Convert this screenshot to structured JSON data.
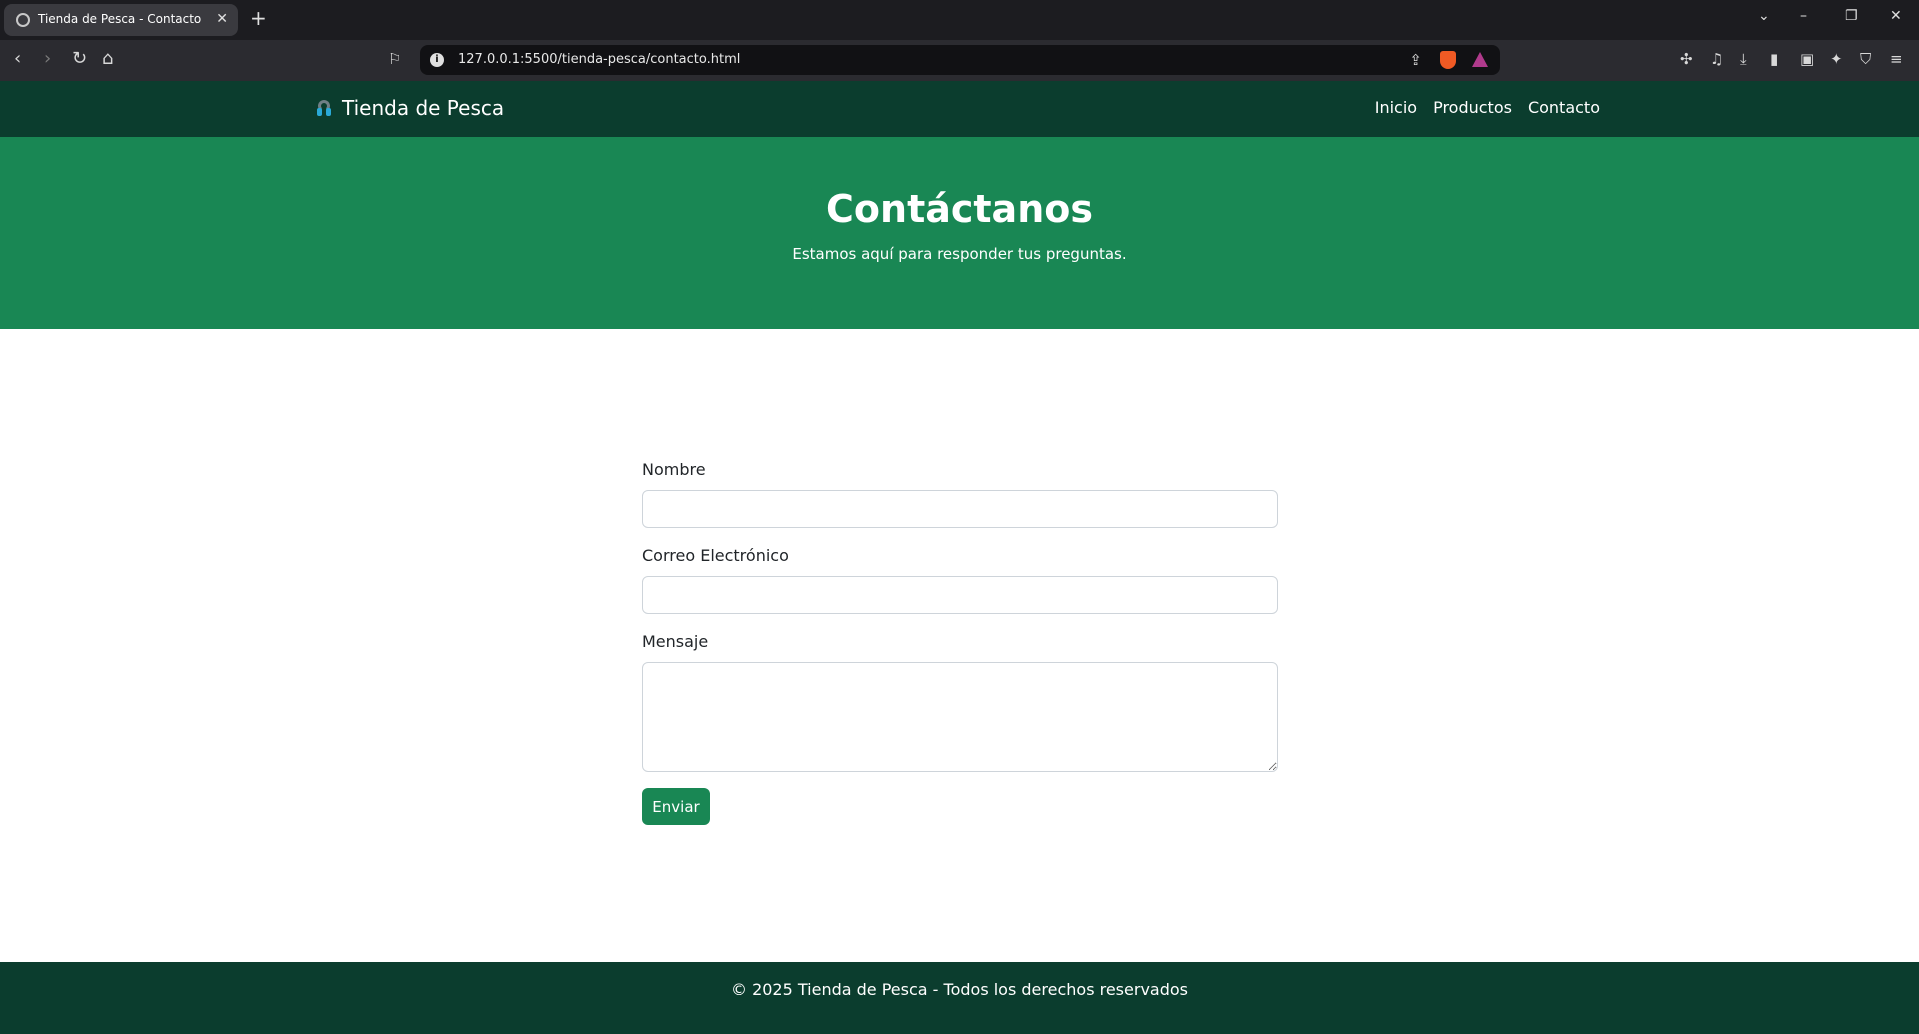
{
  "browser": {
    "tab_title": "Tienda de Pesca - Contacto",
    "url": "127.0.0.1:5500/tienda-pesca/contacto.html"
  },
  "navbar": {
    "brand": "Tienda de Pesca",
    "links": [
      "Inicio",
      "Productos",
      "Contacto"
    ]
  },
  "hero": {
    "title": "Contáctanos",
    "subtitle": "Estamos aquí para responder tus preguntas."
  },
  "form": {
    "name_label": "Nombre",
    "name_value": "",
    "email_label": "Correo Electrónico",
    "email_value": "",
    "message_label": "Mensaje",
    "message_value": "",
    "submit_label": "Enviar"
  },
  "footer": {
    "text": "© 2025 Tienda de Pesca - Todos los derechos reservados"
  },
  "colors": {
    "navbar_bg": "#0b3d2e",
    "hero_bg": "#198754",
    "button_bg": "#198754"
  }
}
